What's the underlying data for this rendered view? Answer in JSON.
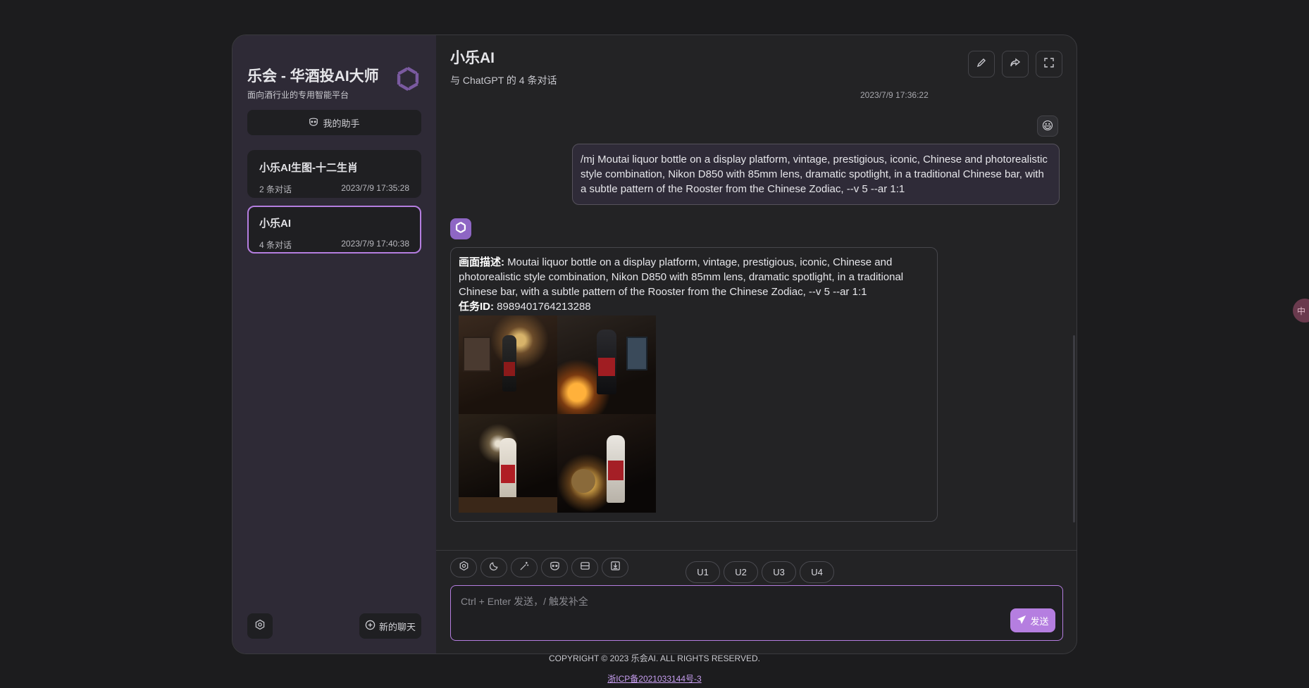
{
  "sidebar": {
    "brand_title": "乐会 - 华酒投AI大师",
    "brand_subtitle": "面向酒行业的专用智能平台",
    "logo_icon": "openai-logo-icon",
    "assistant_label": "我的助手",
    "chats": [
      {
        "title": "小乐AI生图-十二生肖",
        "count": "2 条对话",
        "time": "2023/7/9 17:35:28",
        "active": false
      },
      {
        "title": "小乐AI",
        "count": "4 条对话",
        "time": "2023/7/9 17:40:38",
        "active": true
      }
    ],
    "new_chat_label": "新的聊天"
  },
  "header": {
    "title": "小乐AI",
    "subtitle": "与 ChatGPT 的 4 条对话",
    "actions": [
      "edit-icon",
      "share-icon",
      "fullscreen-icon"
    ]
  },
  "messages": {
    "top_timestamp": "2023/7/9 17:36:22",
    "user_avatar": "😃",
    "user_text": "/mj Moutai liquor bottle on a display platform, vintage, prestigious, iconic, Chinese and photorealistic style combination, Nikon D850 with 85mm lens, dramatic spotlight, in a traditional Chinese bar, with a subtle pattern of the Rooster from the Chinese Zodiac, --v 5 --ar 1:1",
    "bot_desc_label": "画面描述:",
    "bot_desc": " Moutai liquor bottle on a display platform, vintage, prestigious, iconic, Chinese and photorealistic style combination, Nikon D850 with 85mm lens, dramatic spotlight, in a traditional Chinese bar, with a subtle pattern of the Rooster from the Chinese Zodiac, --v 5 --ar 1:1",
    "task_label": "任务ID:",
    "task_id": " 8989401764213288",
    "upscale_buttons": [
      "U1",
      "U2",
      "U3",
      "U4"
    ]
  },
  "input": {
    "placeholder": "Ctrl + Enter 发送，/ 触发补全",
    "send_label": "发送",
    "tools": [
      "settings-icon",
      "moon-icon",
      "magic-wand-icon",
      "mask-icon",
      "layout-icon",
      "export-icon"
    ]
  },
  "footer": {
    "copyright": "COPYRIGHT © 2023 乐会AI. ALL RIGHTS RESERVED.",
    "icp": "浙ICP备2021033144号-3"
  },
  "float_chip": "中"
}
